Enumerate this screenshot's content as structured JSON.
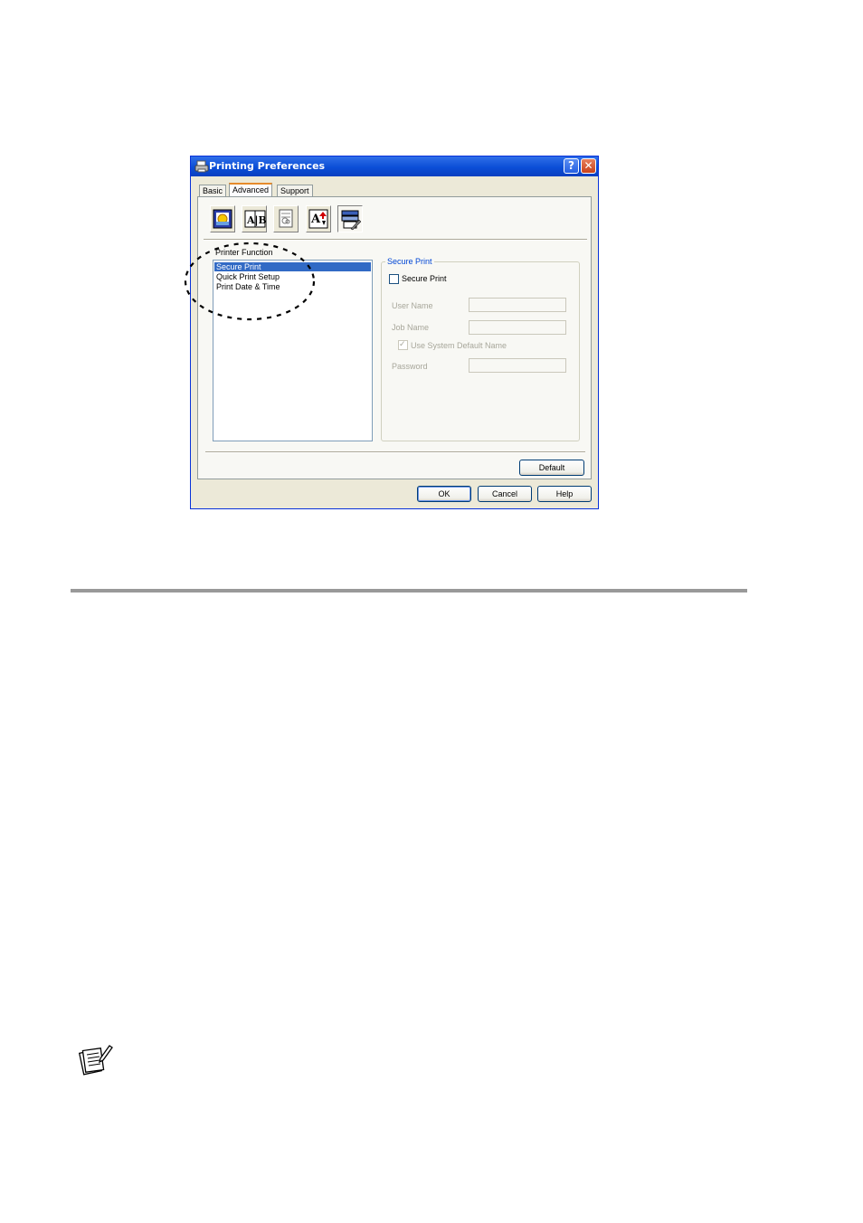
{
  "dialog": {
    "title": "Printing Preferences",
    "help_glyph": "?",
    "close_glyph": "✕",
    "tabs": [
      {
        "label": "Basic",
        "active": false
      },
      {
        "label": "Advanced",
        "active": true
      },
      {
        "label": "Support",
        "active": false
      }
    ],
    "toolbar": {
      "icons": [
        "watermark-icon",
        "page-setting-icon",
        "header-footer-icon",
        "toner-save-icon",
        "printer-function-icon"
      ],
      "selected": "printer-function-icon",
      "ab_text": "A|B",
      "a_text": "A"
    },
    "printer_function": {
      "label": "Printer Function",
      "items": [
        "Secure Print",
        "Quick Print Setup",
        "Print Date & Time"
      ],
      "selected_index": 0
    },
    "secure_print": {
      "group_title": "Secure Print",
      "checkbox_label": "Secure Print",
      "checked": false,
      "user_name_label": "User Name",
      "user_name_value": "",
      "job_name_label": "Job Name",
      "job_name_value": "",
      "use_default_label": "Use System Default Name",
      "use_default_checked": true,
      "password_label": "Password",
      "password_value": ""
    },
    "default_button": "Default",
    "ok_button": "OK",
    "cancel_button": "Cancel",
    "help_button": "Help"
  },
  "colors": {
    "titlebar": "#0b4ed7",
    "selection": "#316ac5",
    "group_title": "#0046d5"
  }
}
